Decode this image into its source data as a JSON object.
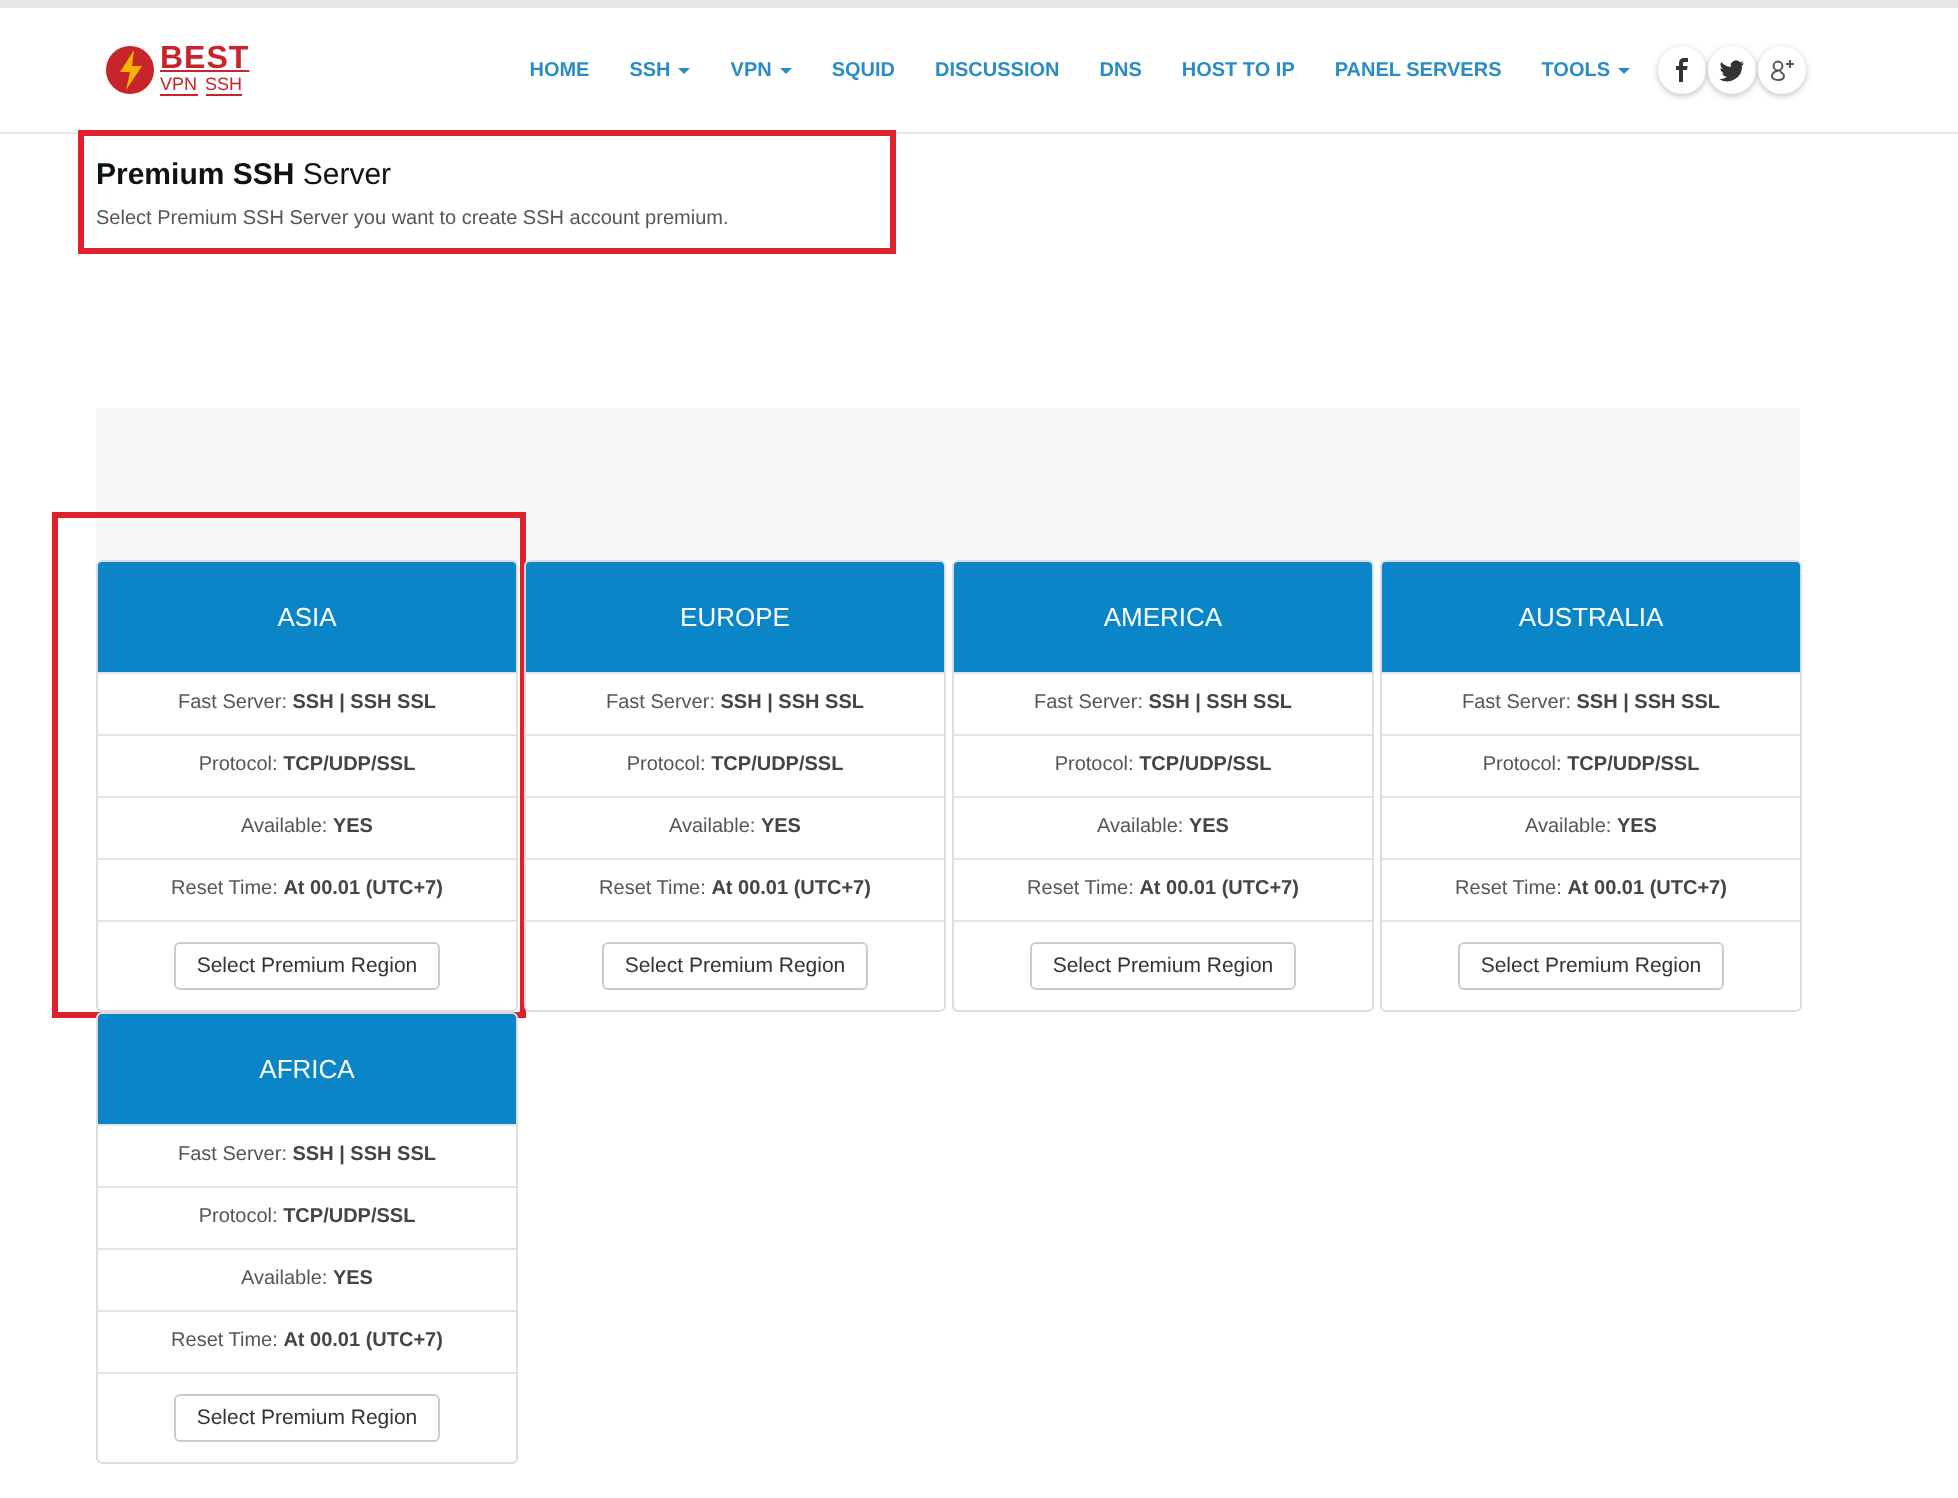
{
  "logo": {
    "main": "BEST",
    "sub": "VPN",
    "tag": "SSH"
  },
  "nav": [
    {
      "label": "HOME",
      "dropdown": false
    },
    {
      "label": "SSH",
      "dropdown": true
    },
    {
      "label": "VPN",
      "dropdown": true
    },
    {
      "label": "SQUID",
      "dropdown": false
    },
    {
      "label": "DISCUSSION",
      "dropdown": false
    },
    {
      "label": "DNS",
      "dropdown": false
    },
    {
      "label": "HOST TO IP",
      "dropdown": false
    },
    {
      "label": "PANEL SERVERS",
      "dropdown": false
    },
    {
      "label": "TOOLS",
      "dropdown": true
    }
  ],
  "social": [
    {
      "kind": "facebook"
    },
    {
      "kind": "twitter"
    },
    {
      "kind": "google-plus"
    }
  ],
  "intro": {
    "title": "**Premium SSH** Server",
    "subtitle": "Select Premium SSH Server you want to create SSH account premium.",
    "highlighted": true
  },
  "regions": [
    {
      "name": "ASIA",
      "highlighted": true,
      "rows": [
        "Fast Server: **SSH | SSH SSL**",
        "Protocol: **TCP/UDP/SSL**",
        "Available: **YES**",
        "Reset Time: **At 00.01 (UTC+7)**"
      ],
      "button": "Select Premium Region"
    },
    {
      "name": "EUROPE",
      "highlighted": false,
      "rows": [
        "Fast Server: **SSH | SSH SSL**",
        "Protocol: **TCP/UDP/SSL**",
        "Available: **YES**",
        "Reset Time: **At 00.01 (UTC+7)**"
      ],
      "button": "Select Premium Region"
    },
    {
      "name": "AMERICA",
      "highlighted": false,
      "rows": [
        "Fast Server: **SSH | SSH SSL**",
        "Protocol: **TCP/UDP/SSL**",
        "Available: **YES**",
        "Reset Time: **At 00.01 (UTC+7)**"
      ],
      "button": "Select Premium Region"
    },
    {
      "name": "AUSTRALIA",
      "highlighted": false,
      "rows": [
        "Fast Server: **SSH | SSH SSL**",
        "Protocol: **TCP/UDP/SSL**",
        "Available: **YES**",
        "Reset Time: **At 00.01 (UTC+7)**"
      ],
      "button": "Select Premium Region"
    },
    {
      "name": "AFRICA",
      "highlighted": false,
      "rows": [
        "Fast Server: **SSH | SSH SSL**",
        "Protocol: **TCP/UDP/SSL**",
        "Available: **YES**",
        "Reset Time: **At 00.01 (UTC+7)**"
      ],
      "button": "Select Premium Region"
    }
  ]
}
